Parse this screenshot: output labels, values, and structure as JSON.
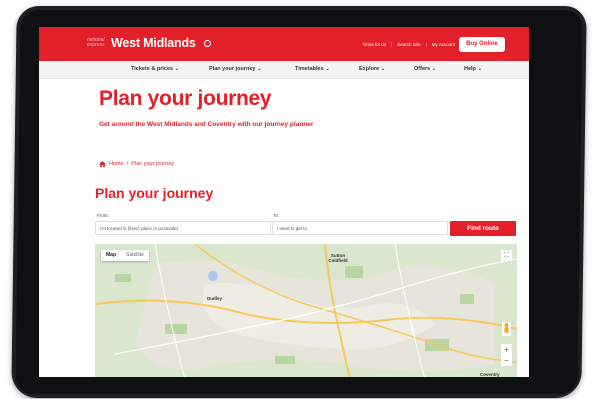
{
  "header": {
    "logo_small": "national express",
    "logo_main": "West Midlands",
    "top_links": [
      "Drive for us",
      "Search Site",
      "My Account"
    ],
    "buy_online": "Buy Online"
  },
  "nav": {
    "items": [
      "Tickets & prices",
      "Plan your journey",
      "Timetables",
      "Explore",
      "Offers",
      "Help"
    ]
  },
  "hero": {
    "title": "Plan your journey",
    "subtitle": "Get around the West Midlands and Coventry with our journey planner"
  },
  "breadcrumb": {
    "home": "Home",
    "separator": "/",
    "current": "Plan your journey"
  },
  "planner": {
    "title": "Plan your journey",
    "from_label": "From:",
    "from_placeholder": "I'm located in (fixed, place or postcode)",
    "to_label": "To:",
    "to_placeholder": "I need to get to",
    "find_route": "Find route"
  },
  "map": {
    "tab_map": "Map",
    "tab_satellite": "Satellite",
    "labels": [
      "Sutton Coldfield",
      "Dudley",
      "Coventry"
    ],
    "zoom_in": "+",
    "zoom_out": "−"
  },
  "colors": {
    "brand_red": "#e3202a",
    "tablet_body": "#1d1f22",
    "map_green": "#dbe6cf"
  }
}
